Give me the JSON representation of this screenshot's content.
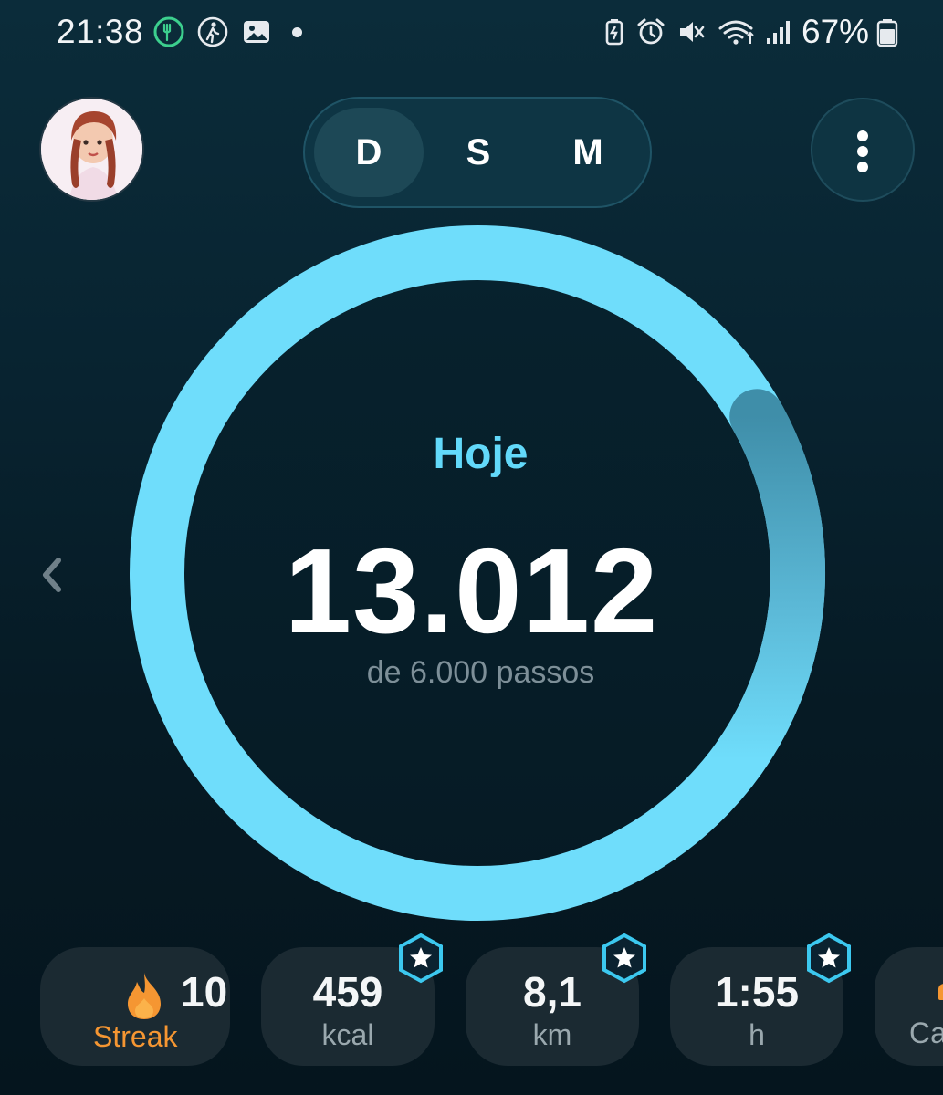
{
  "status_bar": {
    "time": "21:38",
    "battery_percent": "67%",
    "left_icons": [
      "food-tracker-icon",
      "walking-icon",
      "image-icon",
      "notification-dot"
    ],
    "right_icons": [
      "battery-saver-icon",
      "alarm-icon",
      "mute-icon",
      "wifi-icon",
      "signal-icon",
      "battery-icon"
    ]
  },
  "header": {
    "period_tabs": [
      {
        "label": "D",
        "active": true
      },
      {
        "label": "S",
        "active": false
      },
      {
        "label": "M",
        "active": false
      }
    ]
  },
  "progress": {
    "title": "Hoje",
    "steps": "13.012",
    "goal_text": "de 6.000 passos",
    "steps_value": 13012,
    "goal_value": 6000,
    "ring_color": "#6fddfb"
  },
  "stats": {
    "streak": {
      "value": "10",
      "label": "Streak"
    },
    "calories": {
      "value": "459",
      "unit": "kcal"
    },
    "distance": {
      "value": "8,1",
      "unit": "km"
    },
    "time": {
      "value": "1:55",
      "unit": "h"
    },
    "partial": {
      "unit": "Ca"
    }
  },
  "colors": {
    "accent": "#62d9fa",
    "streak": "#f59632",
    "card_bg": "#1b2a32"
  }
}
